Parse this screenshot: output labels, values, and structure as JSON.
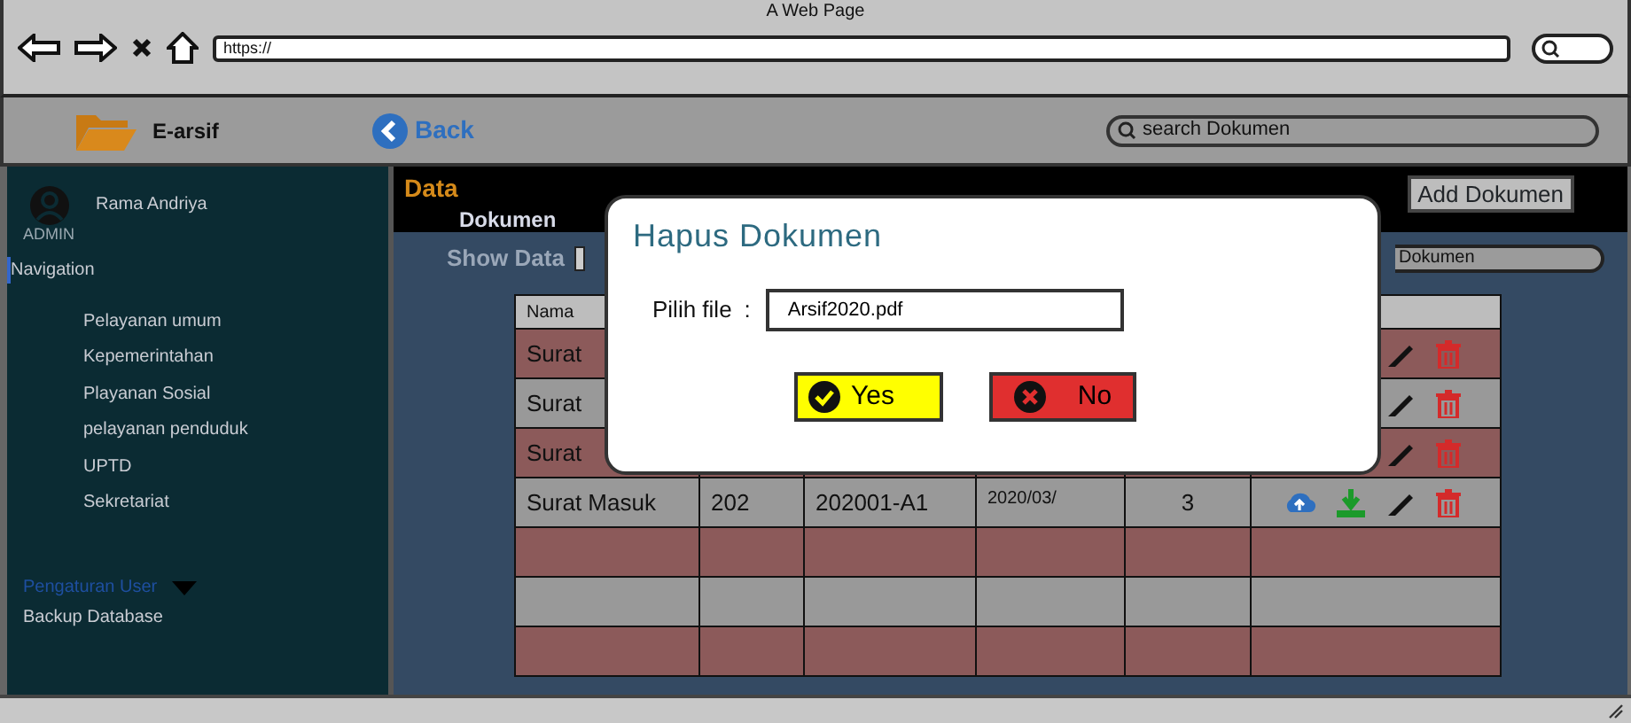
{
  "browser": {
    "title": "A Web Page",
    "url": "https://"
  },
  "app_bar": {
    "logo": "E-arsif",
    "back": "Back",
    "search_placeholder": "search Dokumen"
  },
  "sidebar": {
    "user": "Rama Andriya",
    "role": "ADMIN",
    "heading": "Navigation",
    "items": [
      "Pelayanan umum",
      "Kepemerintahan",
      "Playanan Sosial",
      "pelayanan penduduk",
      "UPTD",
      "Sekretariat"
    ],
    "settings": "Pengaturan User",
    "backup": "Backup Database"
  },
  "page": {
    "title_top": "Data",
    "title_bottom": "Dokumen",
    "add_button": "Add Dokumen",
    "show_data": "Show Data",
    "search_value": "Dokumen"
  },
  "table": {
    "columns": [
      "Nama"
    ],
    "rows": [
      {
        "kind": "covered",
        "cells": [
          "Surat"
        ]
      },
      {
        "kind": "covered",
        "cells": [
          "Surat"
        ]
      },
      {
        "kind": "covered",
        "cells": [
          "Surat"
        ]
      },
      {
        "kind": "full",
        "cells": [
          "Surat Masuk",
          "202",
          "202001-A1",
          "2020/03/",
          "3"
        ]
      },
      {
        "kind": "empty"
      },
      {
        "kind": "empty"
      },
      {
        "kind": "empty"
      }
    ]
  },
  "dialog": {
    "title": "Hapus Dokumen",
    "field_label": "Pilih file",
    "separator": ":",
    "file": "Arsif2020.pdf",
    "buttons": [
      {
        "kind": "yes",
        "label": "Yes"
      },
      {
        "kind": "no",
        "label": "No"
      }
    ]
  }
}
